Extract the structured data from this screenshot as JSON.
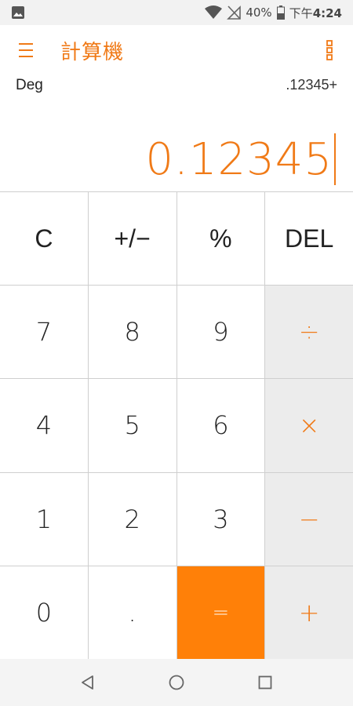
{
  "status": {
    "battery": "40%",
    "time_prefix": "下午",
    "time": "4:24"
  },
  "app": {
    "title": "計算機"
  },
  "display": {
    "mode": "Deg",
    "history": ".12345+",
    "result": "0.12345"
  },
  "keys": [
    {
      "label": "C",
      "kind": "fn"
    },
    {
      "label": "+/−",
      "kind": "fn"
    },
    {
      "label": "%",
      "kind": "fn"
    },
    {
      "label": "DEL",
      "kind": "fn"
    },
    {
      "label": "7",
      "kind": "digit"
    },
    {
      "label": "8",
      "kind": "digit"
    },
    {
      "label": "9",
      "kind": "digit"
    },
    {
      "label": "÷",
      "kind": "op"
    },
    {
      "label": "4",
      "kind": "digit"
    },
    {
      "label": "5",
      "kind": "digit"
    },
    {
      "label": "6",
      "kind": "digit"
    },
    {
      "label": "×",
      "kind": "op"
    },
    {
      "label": "1",
      "kind": "digit"
    },
    {
      "label": "2",
      "kind": "digit"
    },
    {
      "label": "3",
      "kind": "digit"
    },
    {
      "label": "−",
      "kind": "op"
    },
    {
      "label": "0",
      "kind": "digit"
    },
    {
      "label": ".",
      "kind": "digit"
    },
    {
      "label": "=",
      "kind": "equals"
    },
    {
      "label": "+",
      "kind": "op"
    }
  ],
  "colors": {
    "accent": "#f07a17",
    "equals_bg": "#ff8008",
    "operator_bg": "#ececec"
  },
  "icons": {
    "status_left": "image-icon",
    "wifi": "wifi-icon",
    "signal": "no-signal-icon",
    "battery": "battery-icon",
    "menu": "hamburger-menu-icon",
    "more": "more-vert-icon",
    "nav_back": "back-triangle-icon",
    "nav_home": "home-circle-icon",
    "nav_recents": "recents-square-icon"
  }
}
